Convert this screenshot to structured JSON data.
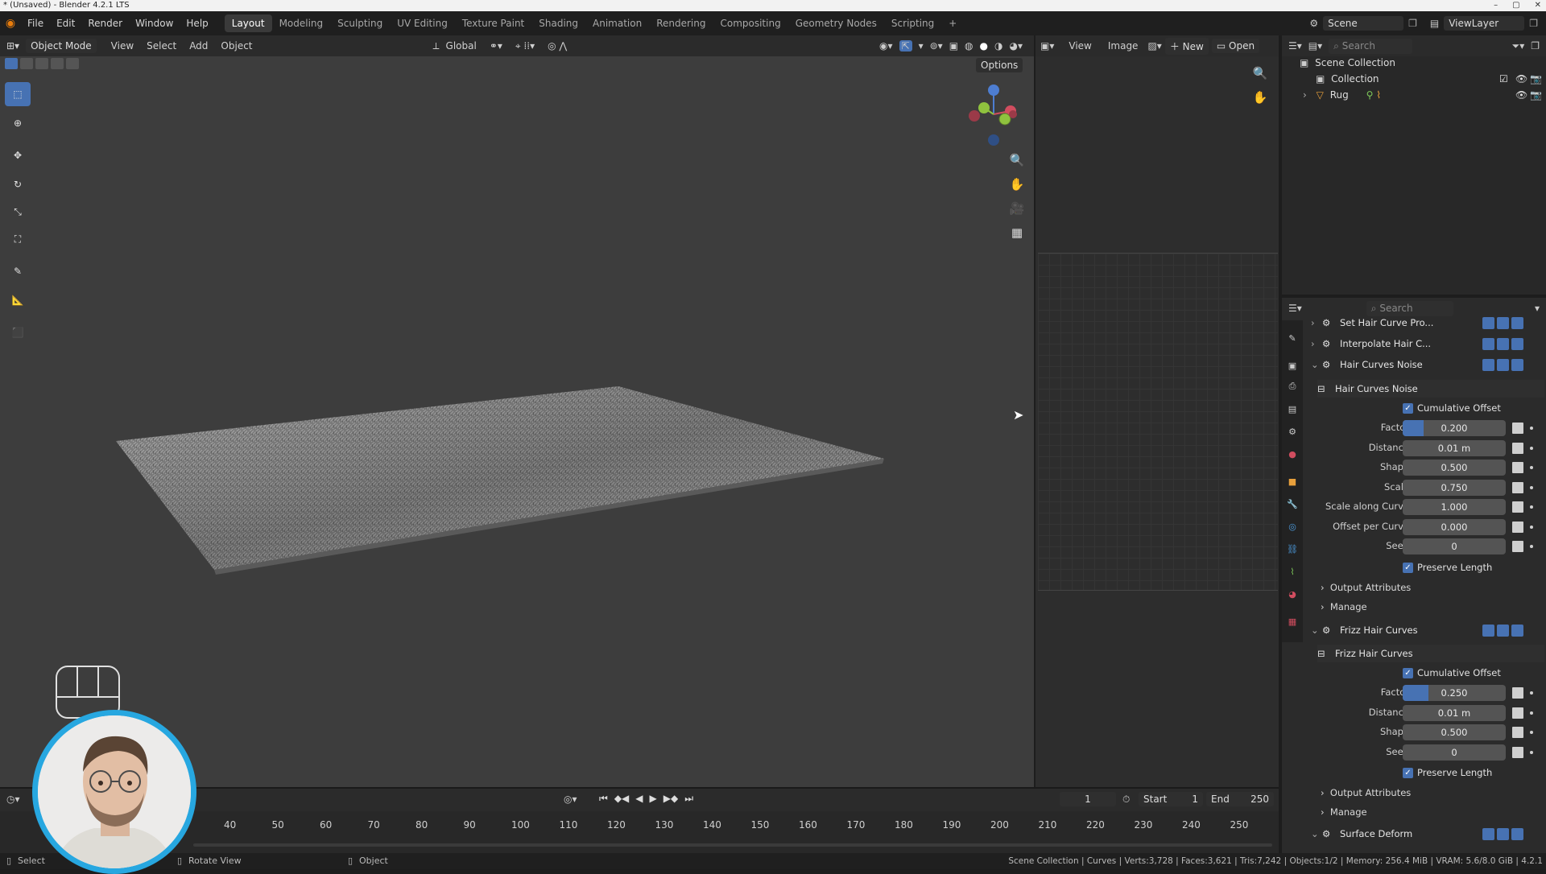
{
  "window": {
    "title": "* (Unsaved) - Blender 4.2.1 LTS",
    "controls": [
      "–",
      "▢",
      "✕"
    ]
  },
  "menu": [
    "File",
    "Edit",
    "Render",
    "Window",
    "Help"
  ],
  "workspaces": [
    "Layout",
    "Modeling",
    "Sculpting",
    "UV Editing",
    "Texture Paint",
    "Shading",
    "Animation",
    "Rendering",
    "Compositing",
    "Geometry Nodes",
    "Scripting",
    "+"
  ],
  "active_workspace": "Layout",
  "scene": {
    "label": "Scene",
    "viewlayer": "ViewLayer"
  },
  "viewport": {
    "mode": "Object Mode",
    "menus": [
      "View",
      "Select",
      "Add",
      "Object"
    ],
    "transform_orientation": "Global",
    "options_label": "Options"
  },
  "image_editor": {
    "menus": [
      "View",
      "Image"
    ],
    "new_label": "New",
    "open_label": "Open"
  },
  "outliner": {
    "search_placeholder": "Search",
    "scene_collection": "Scene Collection",
    "collection": "Collection",
    "object": "Rug"
  },
  "properties": {
    "search_placeholder": "Search",
    "modifiers": {
      "set_hair": "Set Hair Curve Pro...",
      "interpolate": "Interpolate Hair C...",
      "noise": {
        "title": "Hair Curves Noise",
        "node_group": "Hair Curves Noise",
        "cumulative_offset": "Cumulative Offset",
        "fields": [
          {
            "label": "Factor",
            "value": "0.200",
            "fill": 0.2
          },
          {
            "label": "Distance",
            "value": "0.01 m"
          },
          {
            "label": "Shape",
            "value": "0.500"
          },
          {
            "label": "Scale",
            "value": "0.750"
          },
          {
            "label": "Scale along Curve",
            "value": "1.000"
          },
          {
            "label": "Offset per Curve",
            "value": "0.000"
          },
          {
            "label": "Seed",
            "value": "0"
          }
        ],
        "preserve_length": "Preserve Length",
        "output_attributes": "Output Attributes",
        "manage": "Manage"
      },
      "frizz": {
        "title": "Frizz Hair Curves",
        "node_group": "Frizz Hair Curves",
        "cumulative_offset": "Cumulative Offset",
        "fields": [
          {
            "label": "Factor",
            "value": "0.250",
            "fill": 0.25
          },
          {
            "label": "Distance",
            "value": "0.01 m"
          },
          {
            "label": "Shape",
            "value": "0.500"
          },
          {
            "label": "Seed",
            "value": "0"
          }
        ],
        "preserve_length": "Preserve Length",
        "output_attributes": "Output Attributes",
        "manage": "Manage"
      },
      "surface_deform": "Surface Deform"
    }
  },
  "timeline": {
    "current_frame": "1",
    "start_label": "Start",
    "start": "1",
    "end_label": "End",
    "end": "250",
    "ticks": [
      "40",
      "50",
      "60",
      "70",
      "80",
      "90",
      "100",
      "110",
      "120",
      "130",
      "140",
      "150",
      "160",
      "170",
      "180",
      "190",
      "200",
      "210",
      "220",
      "230",
      "240",
      "250"
    ]
  },
  "statusbar": {
    "select": "Select",
    "rotate": "Rotate View",
    "object": "Object",
    "stats": "Scene Collection | Curves | Verts:3,728 | Faces:3,621 | Tris:7,242 | Objects:1/2 | Memory: 256.4 MiB | VRAM: 5.6/8.0 GiB | 4.2.1"
  },
  "colors": {
    "accent": "#4772b3",
    "viewport_bg": "#3d3d3d",
    "webcam_ring": "#27a7e0"
  }
}
